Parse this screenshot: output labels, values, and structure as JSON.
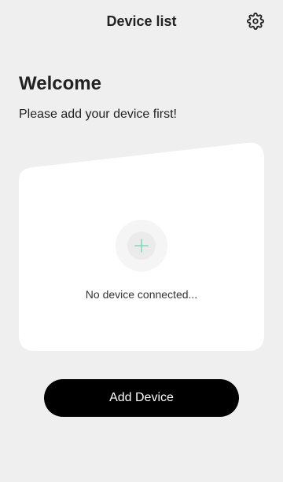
{
  "header": {
    "title": "Device list",
    "settings_icon": "gear-icon"
  },
  "welcome": {
    "title": "Welcome",
    "subtitle": "Please add your device first!"
  },
  "device_card": {
    "add_icon": "plus-icon",
    "empty_text": "No device connected..."
  },
  "actions": {
    "add_device_label": "Add Device"
  },
  "colors": {
    "background": "#efefef",
    "card": "#ffffff",
    "accent_plus": "#7fd8bf",
    "button": "#000000",
    "button_text": "#ffffff"
  }
}
